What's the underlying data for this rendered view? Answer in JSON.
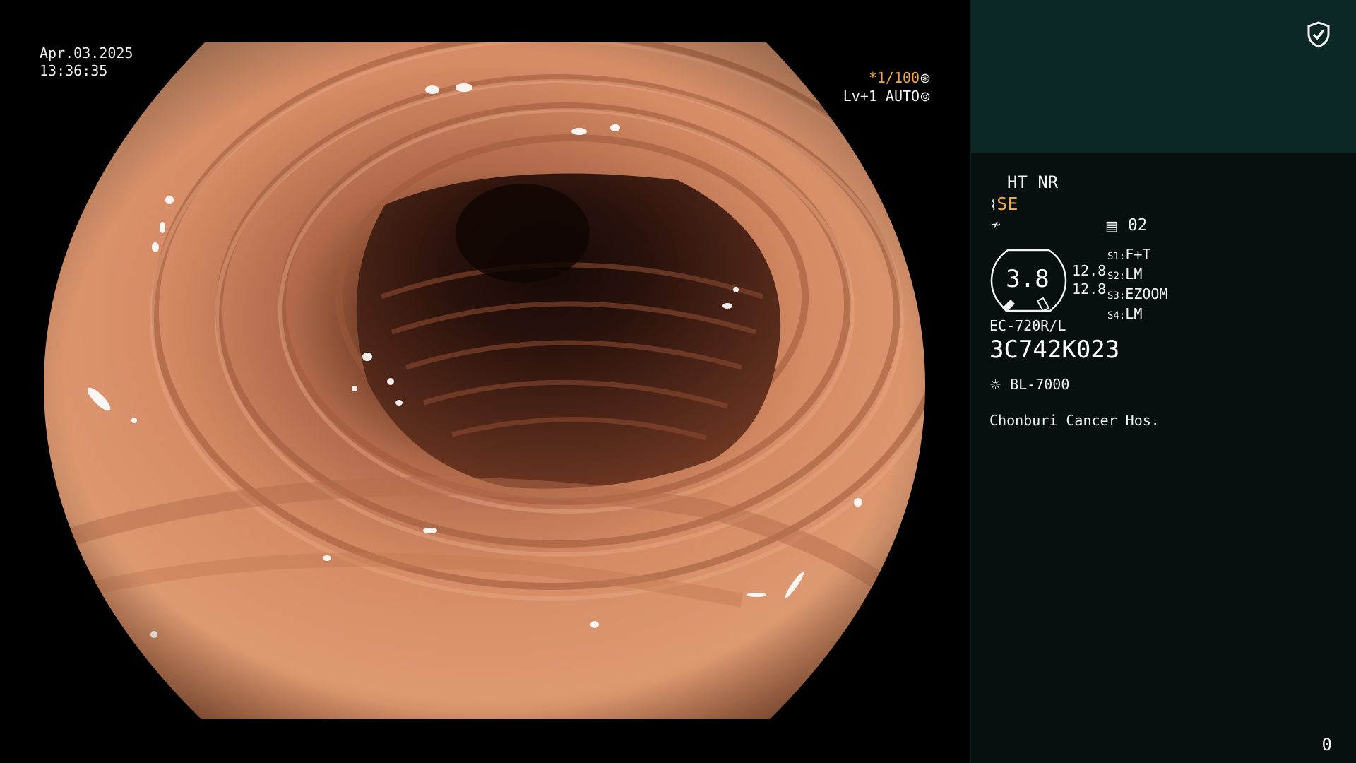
{
  "overlay": {
    "date": "Apr.03.2025",
    "time": "13:36:35",
    "shutter": "*1/100",
    "shutter_icon": "aperture-icon",
    "exposure": "Lv+1 AUTO",
    "exposure_icon": "iris-icon"
  },
  "panel": {
    "header_icon": "shield-check-icon",
    "structure_mode": "HT NR",
    "enhancement_icon": "wave-icon",
    "enhancement": "SE",
    "filter_icon": "slash-curve-icon",
    "mode_icon": "list-box-icon",
    "mode_number": "02",
    "zoom": "3.8",
    "sizes": [
      "12.8",
      "12.8"
    ],
    "switches": [
      {
        "key": "S1:",
        "value": "F+T"
      },
      {
        "key": "S2:",
        "value": "LM"
      },
      {
        "key": "S3:",
        "value": "EZOOM"
      },
      {
        "key": "S4:",
        "value": "LM"
      }
    ],
    "scope_model": "EC-720R/L",
    "serial": "3C742K023",
    "light_icon": "sun-icon",
    "light_source": "BL-7000",
    "hospital": "Chonburi Cancer Hos.",
    "counter": "0"
  },
  "colors": {
    "accent_orange": "#f3a93a",
    "panel_top": "#0c2826",
    "panel_bg": "#08100f"
  }
}
